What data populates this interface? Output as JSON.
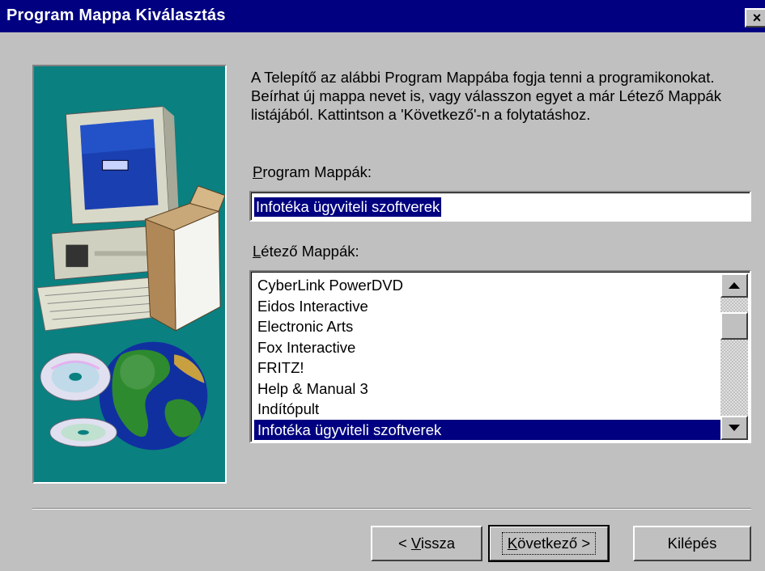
{
  "window": {
    "title": "Program Mappa Kiválasztás",
    "close_glyph": "×"
  },
  "description": "A Telepítő az alábbi Program Mappába fogja tenni a programikonokat. Beírhat új mappa nevet is, vagy válasszon egyet a már Létező Mappák listájából. Kattintson a 'Következő'-n a folytatáshoz.",
  "program_folders": {
    "label_mnemonic": "P",
    "label_rest": "rogram Mappák:",
    "value": "Infotéka ügyviteli szoftverek"
  },
  "existing_folders": {
    "label_mnemonic": "L",
    "label_rest": "étező Mappák:",
    "items": [
      "CyberLink PowerDVD",
      "Eidos Interactive",
      "Electronic Arts",
      "Fox Interactive",
      "FRITZ!",
      "Help & Manual 3",
      "Indítópult",
      "Infotéka ügyviteli szoftverek"
    ],
    "selected": "Infotéka ügyviteli szoftverek"
  },
  "buttons": {
    "back_prefix": "< ",
    "back_mnemonic": "V",
    "back_rest": "issza",
    "next_mnemonic": "K",
    "next_rest": "övetkező >",
    "exit": "Kilépés"
  },
  "colors": {
    "titlebar": "#000080",
    "dialog_bg": "#c0c0c0",
    "illustration_bg": "#0a8080",
    "selection": "#000080"
  }
}
